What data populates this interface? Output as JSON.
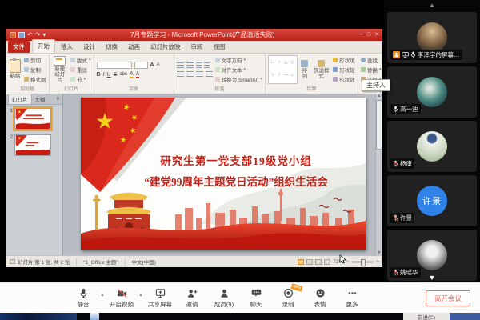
{
  "window": {
    "title": "7月专题学习 - Microsoft PowerPoint(产品激活失败)",
    "controls": {
      "minimize": "─",
      "maximize": "□",
      "close": "✕"
    }
  },
  "icons": {
    "undo": "↶",
    "redo": "↷",
    "dropdown": "▾",
    "scroll_up": "▲",
    "scroll_down": "▼",
    "caret_up": "▲"
  },
  "ribbon": {
    "tabs": [
      "文件",
      "开始",
      "插入",
      "设计",
      "切换",
      "动画",
      "幻灯片放映",
      "审阅",
      "视图"
    ],
    "groups": {
      "clipboard": {
        "label": "剪贴板",
        "paste": "粘贴",
        "cut": "剪切",
        "copy": "复制",
        "format_painter": "格式刷"
      },
      "slides": {
        "label": "幻灯片",
        "new_slide": "新建幻灯片",
        "layout": "版式",
        "reset": "重设",
        "section": "节"
      },
      "font": {
        "label": "字体",
        "bold": "B",
        "italic": "I",
        "underline": "U",
        "strike": "S",
        "abc": "abc",
        "grow": "A",
        "shrink": "A",
        "color": "A"
      },
      "paragraph": {
        "label": "段落",
        "text_direction": "文字方向",
        "align_text": "对齐文本",
        "smartart": "转换为 SmartArt"
      },
      "drawing": {
        "label": "绘图",
        "arrange": "排列",
        "quick_styles": "快速样式",
        "shape_fill": "形状填充",
        "shape_outline": "形状轮廓",
        "shape_effects": "形状效果"
      },
      "editing": {
        "label": "编辑",
        "find": "查找",
        "replace": "替换",
        "select": "选择"
      }
    }
  },
  "slides_panel": {
    "tab_slides": "幻灯片",
    "tab_outline": "大纲",
    "close": "✕",
    "numbers": [
      "1",
      "2"
    ]
  },
  "slide": {
    "line1": "研究生第一党支部19级党小组",
    "line2": "“建党99周年主题党日活动”组织生活会"
  },
  "status_bar": {
    "slide_info": "幻灯片 第 1 张, 共 2 张",
    "theme": "“1_Office 主题”",
    "language": "中文(中国)",
    "zoom_level": "72%",
    "zoom_out": "−",
    "zoom_in": "+"
  },
  "meeting": {
    "tooltip_host": "主持人",
    "participants": [
      {
        "name": "李泽宇的屏幕…",
        "mic": "on",
        "host": true,
        "sharing": true
      },
      {
        "name": "高一迪",
        "mic": "on"
      },
      {
        "name": "杨康",
        "mic": "muted"
      },
      {
        "name": "许景",
        "avatar_text": "许景",
        "mic": "muted"
      },
      {
        "name": "姚瑶华",
        "mic": "muted"
      }
    ],
    "toolbar": {
      "mute": "静音",
      "video": "开启视频",
      "share": "共享屏幕",
      "invite": "邀请",
      "members": "成员(9)",
      "chat": "聊天",
      "record": "录制",
      "record_badge": "New",
      "emoji": "表情",
      "more": "更多",
      "leave": "离开会议"
    }
  },
  "taskbar": {
    "fragment": "前进(C)"
  }
}
